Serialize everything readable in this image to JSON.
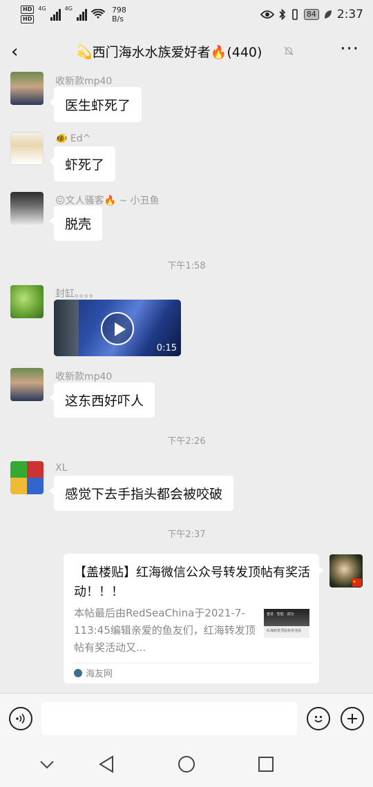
{
  "status_bar": {
    "hd1": "HD",
    "hd2": "HD",
    "net1": "4G",
    "net2": "4G",
    "speed_value": "798",
    "speed_unit": "B/s",
    "battery": "84",
    "time": "2:37"
  },
  "header": {
    "back_icon": "‹",
    "title": "💫西门海水水族爱好者🔥(440)",
    "more_icon": "···"
  },
  "messages": [
    {
      "sender": "收新款mp40",
      "text": "医生虾死了"
    },
    {
      "sender": "🐠 Ed^",
      "text": "虾死了"
    },
    {
      "sender": "😖文人骚客🔥 ~ 小丑鱼",
      "text": "脱壳"
    },
    {
      "sender": "封缸。。。。",
      "video_duration": "0:15"
    },
    {
      "sender": "收新款mp40",
      "text": "这东西好吓人"
    },
    {
      "sender": "XL",
      "text": "感觉下去手指头都会被咬破"
    }
  ],
  "timestamps": [
    "下午1:58",
    "下午2:26",
    "下午2:37"
  ],
  "link_card": {
    "title": "【盖楼贴】红海微信公众号转发顶帖有奖活动！！！",
    "description": "本帖最后由RedSeaChina于2021-7-113:45编辑亲爱的鱼友们，红海转发顶帖有奖活动又...",
    "thumb_top": "奋进 · 智能 · 成功",
    "thumb_bottom": "红海转发顶帖有奖活动",
    "source": "海友网"
  },
  "input_bar": {
    "voice_icon": "voice-icon",
    "emoji_icon": "emoji-icon",
    "plus_icon": "plus-icon"
  },
  "colors": {
    "background": "#ededed",
    "bubble": "#ffffff",
    "meta_text": "#999999"
  }
}
